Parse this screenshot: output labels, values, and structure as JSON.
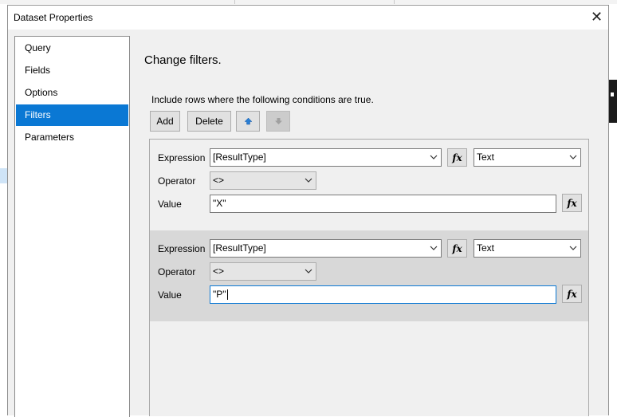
{
  "dialog": {
    "title": "Dataset Properties"
  },
  "nav": {
    "items": [
      {
        "label": "Query",
        "selected": false
      },
      {
        "label": "Fields",
        "selected": false
      },
      {
        "label": "Options",
        "selected": false
      },
      {
        "label": "Filters",
        "selected": true
      },
      {
        "label": "Parameters",
        "selected": false
      }
    ]
  },
  "content": {
    "heading": "Change filters.",
    "instruction": "Include rows where the following conditions are true.",
    "buttons": {
      "add": "Add",
      "delete": "Delete"
    }
  },
  "filters": [
    {
      "expression_label": "Expression",
      "expression": "[ResultType]",
      "type": "Text",
      "operator_label": "Operator",
      "operator": "<>",
      "value_label": "Value",
      "value": "\"X\""
    },
    {
      "expression_label": "Expression",
      "expression": "[ResultType]",
      "type": "Text",
      "operator_label": "Operator",
      "operator": "<>",
      "value_label": "Value",
      "value": "\"P\""
    }
  ],
  "fx_label": "fx",
  "colors": {
    "selected": "#0a78d4",
    "alt_row": "#d8d8d8",
    "up_arrow": "#2a7fd4"
  }
}
